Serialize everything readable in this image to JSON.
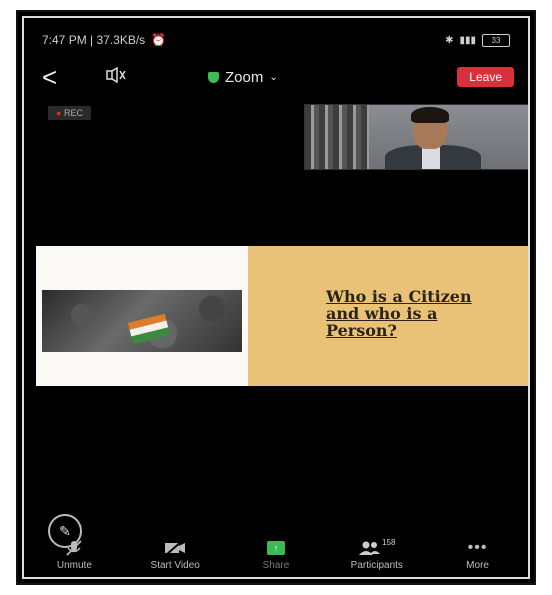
{
  "status": {
    "time_speed": "7:47 PM | 37.3KB/s",
    "battery": "33"
  },
  "meeting": {
    "title": "Zoom",
    "leave_label": "Leave",
    "rec_label": "REC"
  },
  "slide": {
    "title": "Who is a Citizen and who is a Person?"
  },
  "toolbar": {
    "unmute": "Unmute",
    "start_video": "Start Video",
    "share": "Share",
    "participants": "Participants",
    "participants_count": "158",
    "more": "More"
  },
  "colors": {
    "leave": "#d9303a",
    "share": "#3cba54",
    "slide_bg": "#e9c278"
  }
}
